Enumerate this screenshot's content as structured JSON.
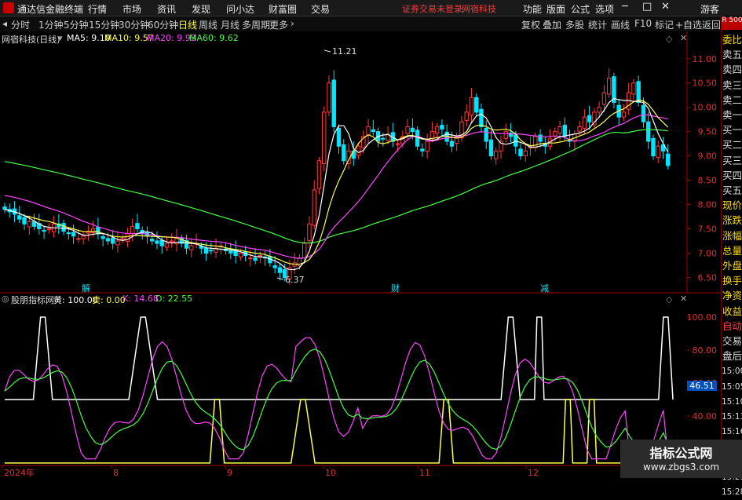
{
  "menubar": {
    "app_name": "通达信金融终端",
    "items": [
      "行情",
      "市场",
      "资讯",
      "发现",
      "问小达",
      "财富圈",
      "交易"
    ],
    "warning": "证券交易未登录",
    "broker": "网宿科技",
    "right_items": [
      "功能",
      "版面",
      "公式",
      "选项"
    ],
    "guest": "游客"
  },
  "toolbar": {
    "periods": [
      "分时",
      "1分钟",
      "5分钟",
      "15分钟",
      "30分钟",
      "60分钟",
      "日线",
      "周线",
      "月线",
      "多周期",
      "更多"
    ],
    "active_period": "日线",
    "right_buttons": [
      "复权",
      "叠加",
      "多股",
      "统计",
      "画线",
      "F10",
      "标记",
      "+自选",
      "返回"
    ]
  },
  "main_chart": {
    "title": "网宿科技(日线)",
    "ma_labels": [
      {
        "text": "MA5: 9.10",
        "color": "#ffffff"
      },
      {
        "text": "MA10: 9.57",
        "color": "#ffff44"
      },
      {
        "text": "MA20: 9.93",
        "color": "#ff44ff"
      },
      {
        "text": "MA60: 9.62",
        "color": "#44ff44"
      }
    ],
    "high_label": "11.21",
    "low_label": "6.37",
    "markers": [
      "解",
      "财",
      "减"
    ]
  },
  "indicator": {
    "title": "股朋指标网",
    "labels": [
      {
        "text": "黄: 100.00",
        "color": "#ffffff"
      },
      {
        "text": "卖: 0.00",
        "color": "#ffff44"
      },
      {
        "text": "K: 14.68",
        "color": "#ff44ff"
      },
      {
        "text": "D: 22.55",
        "color": "#44ff44"
      }
    ],
    "current_value": "46.51"
  },
  "chart_data": [
    {
      "type": "candlestick",
      "title": "网宿科技(日线)",
      "y_ticks": [
        6.5,
        7.0,
        7.5,
        8.0,
        8.5,
        9.0,
        9.5,
        10.0,
        10.5,
        11.0
      ],
      "ylim": [
        6.2,
        11.4
      ],
      "grid": false,
      "closes": [
        7.9,
        7.85,
        7.8,
        7.7,
        7.6,
        7.65,
        7.55,
        7.5,
        7.45,
        7.5,
        7.6,
        7.55,
        7.45,
        7.4,
        7.35,
        7.3,
        7.35,
        7.45,
        7.5,
        7.4,
        7.3,
        7.25,
        7.2,
        7.25,
        7.3,
        7.4,
        7.55,
        7.5,
        7.4,
        7.35,
        7.25,
        7.2,
        7.15,
        7.2,
        7.25,
        7.3,
        7.2,
        7.1,
        7.15,
        7.2,
        7.1,
        7.0,
        7.05,
        7.1,
        7.15,
        7.05,
        7.0,
        6.95,
        7.0,
        6.95,
        6.9,
        6.85,
        6.95,
        6.9,
        6.8,
        6.7,
        6.6,
        6.5,
        6.7,
        6.8,
        6.9,
        7.2,
        7.6,
        8.3,
        8.9,
        9.9,
        10.5,
        9.6,
        9.2,
        8.9,
        9.1,
        8.95,
        9.2,
        9.4,
        9.6,
        9.5,
        9.3,
        9.35,
        9.45,
        9.3,
        9.25,
        9.4,
        9.6,
        9.5,
        9.2,
        9.1,
        9.3,
        9.5,
        9.6,
        9.55,
        9.3,
        9.2,
        9.4,
        9.7,
        9.9,
        10.2,
        9.9,
        9.6,
        9.3,
        9.0,
        9.1,
        9.3,
        9.5,
        9.4,
        9.2,
        9.0,
        9.1,
        9.2,
        9.4,
        9.3,
        9.2,
        9.35,
        9.5,
        9.6,
        9.4,
        9.3,
        9.45,
        9.6,
        9.8,
        9.7,
        9.9,
        10.0,
        10.3,
        10.6,
        10.1,
        9.8,
        9.9,
        10.3,
        10.5,
        10.1,
        9.7,
        9.3,
        9.0,
        9.2,
        9.1,
        8.8
      ],
      "high": 11.21,
      "low": 6.37,
      "series": [
        {
          "name": "MA5",
          "last": 9.1
        },
        {
          "name": "MA10",
          "last": 9.57
        },
        {
          "name": "MA20",
          "last": 9.93
        },
        {
          "name": "MA60",
          "last": 9.62
        }
      ]
    },
    {
      "type": "line",
      "title": "股朋指标网",
      "y_ticks": [
        20,
        40,
        60,
        80,
        100
      ],
      "ylim": [
        10,
        110
      ],
      "x_ticks": [
        "2024年",
        "8",
        "9",
        "10",
        "11",
        "12"
      ],
      "series": [
        {
          "name": "黄",
          "last": 100.0
        },
        {
          "name": "卖",
          "last": 0.0
        },
        {
          "name": "K",
          "last": 14.68
        },
        {
          "name": "D",
          "last": 22.55
        }
      ]
    }
  ],
  "right_panel": {
    "header": "R 500",
    "items": [
      "委比",
      "卖五",
      "卖四",
      "卖三",
      "卖二",
      "卖一",
      "买一",
      "买二",
      "买三",
      "买四",
      "买五",
      "现价",
      "涨跌",
      "涨幅",
      "总量",
      "外盘",
      "换手",
      "净资",
      "收益",
      "自动",
      "交易",
      "盘后",
      "15:00",
      "15:05",
      "15:10",
      "15:13",
      "15:16",
      "15:19",
      "15:22",
      "15:25",
      "15:28"
    ]
  },
  "watermark": {
    "title": "指标公式网",
    "url": "www.zbgs3.com"
  },
  "colors": {
    "up": "#ff3b3b",
    "down": "#00e5ff",
    "ma5": "#ffffff",
    "ma10": "#ffff44",
    "ma20": "#ff44ff",
    "ma60": "#44ff44"
  }
}
